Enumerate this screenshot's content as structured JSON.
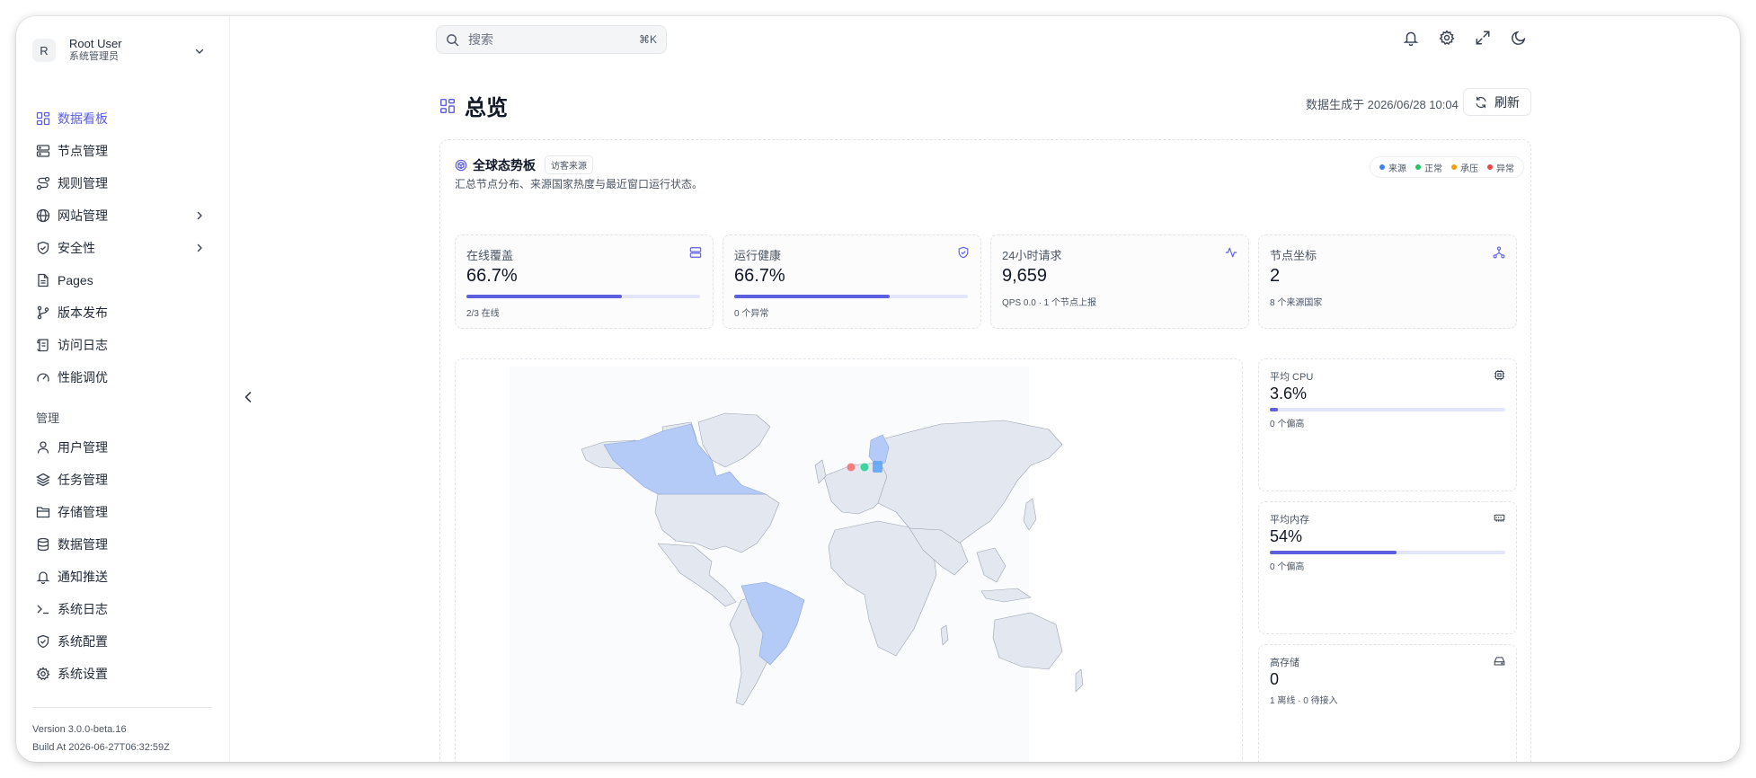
{
  "user": {
    "initial": "R",
    "name": "Root User",
    "role": "系统管理员"
  },
  "nav": {
    "items": [
      {
        "label": "数据看板",
        "icon": "dashboard-icon",
        "active": true
      },
      {
        "label": "节点管理",
        "icon": "server-icon"
      },
      {
        "label": "规则管理",
        "icon": "route-icon"
      },
      {
        "label": "网站管理",
        "icon": "globe-icon",
        "expandable": true
      },
      {
        "label": "安全性",
        "icon": "shield-icon",
        "expandable": true
      },
      {
        "label": "Pages",
        "icon": "file-icon"
      },
      {
        "label": "版本发布",
        "icon": "branch-icon"
      },
      {
        "label": "访问日志",
        "icon": "scroll-icon"
      },
      {
        "label": "性能调优",
        "icon": "gauge-icon"
      }
    ],
    "section_title": "管理",
    "admin_items": [
      {
        "label": "用户管理",
        "icon": "user-icon"
      },
      {
        "label": "任务管理",
        "icon": "layers-icon"
      },
      {
        "label": "存储管理",
        "icon": "folder-icon"
      },
      {
        "label": "数据管理",
        "icon": "database-icon"
      },
      {
        "label": "通知推送",
        "icon": "bell-icon"
      },
      {
        "label": "系统日志",
        "icon": "terminal-icon"
      },
      {
        "label": "系统配置",
        "icon": "shield-icon"
      },
      {
        "label": "系统设置",
        "icon": "gear-icon"
      }
    ],
    "version": "Version 3.0.0-beta.16",
    "build": "Build At 2026-06-27T06:32:59Z"
  },
  "search": {
    "placeholder": "搜索",
    "shortcut": "⌘K"
  },
  "header": {
    "title": "总览",
    "generated": "数据生成于 2026/06/28 10:04",
    "refresh_label": "刷新"
  },
  "panel": {
    "title": "全球态势板",
    "tag": "访客来源",
    "desc": "汇总节点分布、来源国家热度与最近窗口运行状态。",
    "legend": [
      {
        "label": "来源",
        "color": "#3b82f6"
      },
      {
        "label": "正常",
        "color": "#22c55e"
      },
      {
        "label": "承压",
        "color": "#f59e0b"
      },
      {
        "label": "异常",
        "color": "#ef4444"
      }
    ]
  },
  "stats": [
    {
      "label": "在线覆盖",
      "value": "66.7%",
      "progress": 0.667,
      "sub": "2/3 在线",
      "icon": "server-icon"
    },
    {
      "label": "运行健康",
      "value": "66.7%",
      "progress": 0.667,
      "sub": "0 个异常",
      "icon": "shield-check-icon"
    },
    {
      "label": "24小时请求",
      "value": "9,659",
      "sub": "QPS 0.0 · 1 个节点上报",
      "icon": "activity-icon"
    },
    {
      "label": "节点坐标",
      "value": "2",
      "sub": "8 个来源国家",
      "icon": "network-icon"
    }
  ],
  "side_cards": [
    {
      "label": "平均 CPU",
      "value": "3.6%",
      "progress": 0.036,
      "sub": "0 个偏高",
      "icon": "cpu-icon"
    },
    {
      "label": "平均内存",
      "value": "54%",
      "progress": 0.54,
      "sub": "0 个偏高",
      "icon": "memory-icon"
    },
    {
      "label": "高存储",
      "value": "0",
      "sub": "1 离线 · 0 待接入",
      "icon": "hdd-icon"
    }
  ],
  "colors": {
    "accent": "#5b5fe0",
    "map_land": "#e3e8f0",
    "map_highlight": "#b4cbf7"
  }
}
